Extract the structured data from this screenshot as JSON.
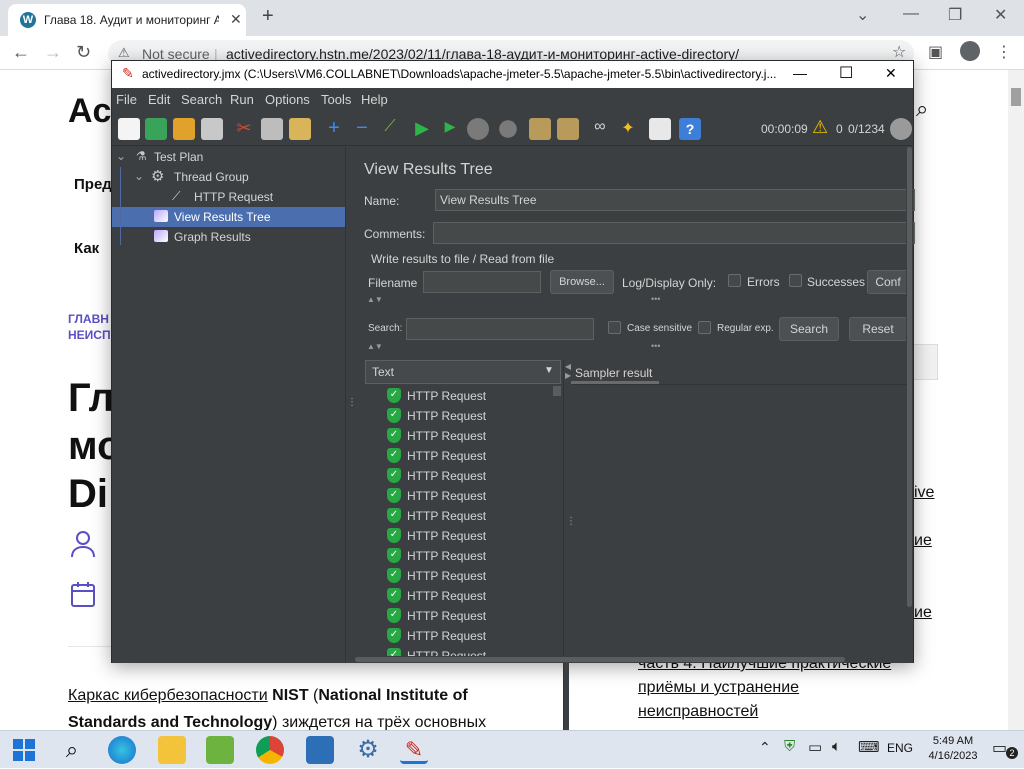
{
  "browser": {
    "tab_title": "Глава 18. Аудит и мониторинг Active",
    "favicon_letter": "W",
    "new_tab": "+",
    "security_label": "Not secure",
    "url_host": "activedirectory.hstn.me",
    "url_path": "/2023/02/11/глава-18-аудит-и-мониторинг-active-directory/",
    "nav_back": "←",
    "nav_forward": "→",
    "nav_reload": "↻",
    "win_min": "—",
    "win_max": "❐",
    "win_close": "✕"
  },
  "web": {
    "logo": "Ac",
    "menu1": "Пред",
    "menu2": "Как",
    "crumb1": "ГЛАВН",
    "crumb2": "НЕИСП",
    "heading_l1": "Гл",
    "heading_l2": "мо",
    "heading_l3": "Di",
    "para_link": "Каркас кибербезопасности",
    "para_b1": "NIST",
    "para_t1": " (",
    "para_b2": "National Institute of",
    "para_b3": "Standards and Technology",
    "para_t2": ") зиждется на трёх основных",
    "side_btn": "ск",
    "side_link1": "ive",
    "side_link2": "ие",
    "side_link3": "ие",
    "side_l4": "часть 4. Наилучшие практические",
    "side_l5": "приёмы и устранение",
    "side_l6": "неисправностей"
  },
  "jmeter": {
    "title": "activedirectory.jmx (C:\\Users\\VM6.COLLABNET\\Downloads\\apache-jmeter-5.5\\apache-jmeter-5.5\\bin\\activedirectory.j...",
    "win_min": "—",
    "win_max": "☐",
    "win_close": "✕",
    "menu": [
      "File",
      "Edit",
      "Search",
      "Run",
      "Options",
      "Tools",
      "Help"
    ],
    "timer": "00:00:09",
    "warn_count": "0",
    "threads": "0/1234",
    "tree": {
      "test_plan": "Test Plan",
      "thread_group": "Thread Group",
      "http_request": "HTTP Request",
      "view_results_tree": "View Results Tree",
      "graph_results": "Graph Results"
    },
    "panel": {
      "heading": "View Results Tree",
      "name_label": "Name:",
      "name_value": "View Results Tree",
      "comments_label": "Comments:",
      "write_results": "Write results to file / Read from file",
      "filename_label": "Filename",
      "browse": "Browse...",
      "log_display": "Log/Display Only:",
      "errors": "Errors",
      "successes": "Successes",
      "configure": "Conf",
      "search_label": "Search:",
      "case_sensitive": "Case sensitive",
      "regular_exp": "Regular exp.",
      "search_btn": "Search",
      "reset_btn": "Reset",
      "renderer": "Text",
      "sampler_tab": "Sampler result"
    },
    "results": [
      "HTTP Request",
      "HTTP Request",
      "HTTP Request",
      "HTTP Request",
      "HTTP Request",
      "HTTP Request",
      "HTTP Request",
      "HTTP Request",
      "HTTP Request",
      "HTTP Request",
      "HTTP Request",
      "HTTP Request",
      "HTTP Request",
      "HTTP Request"
    ]
  },
  "taskbar": {
    "time": "5:49 AM",
    "date": "4/16/2023",
    "lang": "ENG",
    "notif_count": "2"
  },
  "colors": {
    "jmeter_bg": "#3c3f41",
    "selection": "#4b6eaf",
    "success_shield": "#28a745",
    "web_link_purple": "#5b4fc4"
  }
}
